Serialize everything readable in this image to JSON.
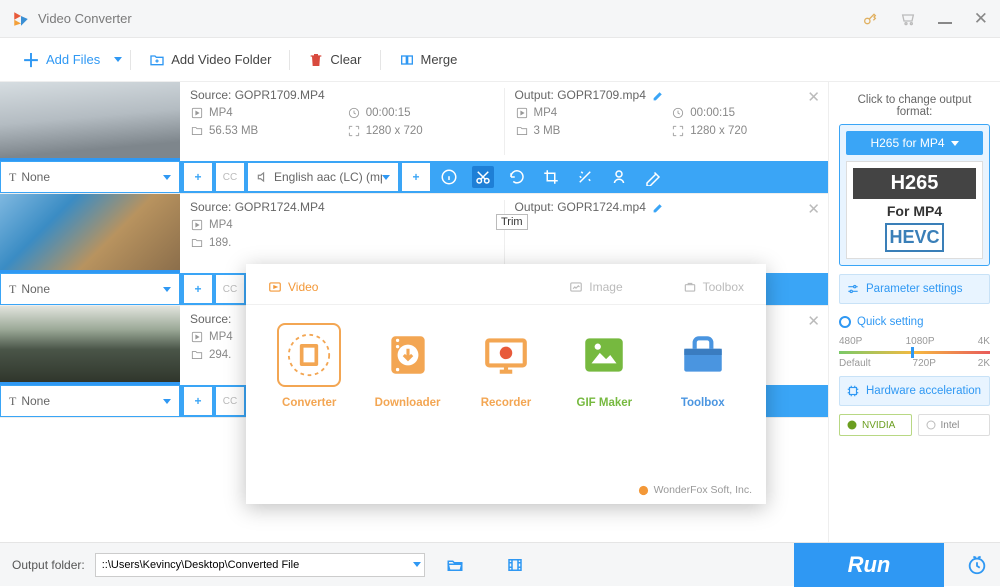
{
  "app": {
    "title": "Video Converter"
  },
  "toolbar": {
    "add_files": "Add Files",
    "add_folder": "Add Video Folder",
    "clear": "Clear",
    "merge": "Merge"
  },
  "files": [
    {
      "thumb_style": "linear-gradient(175deg,#d6dde1 0%,#b4bcc2 45%,#7e868c 80%)",
      "source_label": "Source: GOPR1709.MP4",
      "output_label": "Output: GOPR1709.mp4",
      "src": {
        "format": "MP4",
        "duration": "00:00:15",
        "size": "56.53 MB",
        "res": "1280 x 720"
      },
      "out": {
        "format": "MP4",
        "duration": "00:00:15",
        "size": "3 MB",
        "res": "1280 x 720"
      },
      "subtitle": "None",
      "audio": "English aac (LC) (mp"
    },
    {
      "thumb_style": "linear-gradient(135deg,#7fb8e0 0%,#3a8cc4 30%,#b8935f 60%,#8a6d4a 100%)",
      "source_label": "Source: GOPR1724.MP4",
      "output_label": "Output: GOPR1724.mp4",
      "src": {
        "format": "MP4",
        "size": "189."
      },
      "subtitle": "None"
    },
    {
      "thumb_style": "linear-gradient(180deg,#e2e4dd 0%,#9aa896 30%,#4a5548 55%,#2d3329 100%)",
      "source_label": "Source:",
      "src": {
        "format": "MP4",
        "size": "294."
      },
      "subtitle": "None"
    }
  ],
  "tooltip": {
    "trim": "Trim"
  },
  "popup": {
    "tabs": {
      "video": "Video",
      "image": "Image",
      "toolbox": "Toolbox"
    },
    "modules": {
      "converter": "Converter",
      "downloader": "Downloader",
      "recorder": "Recorder",
      "gif": "GIF Maker",
      "toolbox": "Toolbox"
    },
    "vendor": "WonderFox Soft, Inc."
  },
  "side": {
    "change_label": "Click to change output format:",
    "format_name": "H265 for MP4",
    "codec_top": "H265",
    "codec_mid": "For MP4",
    "codec_bot": "HEVC",
    "params": "Parameter settings",
    "quick": "Quick setting",
    "slider": {
      "p1": "480P",
      "p2": "1080P",
      "p3": "4K",
      "d1": "Default",
      "d2": "720P",
      "d3": "2K"
    },
    "hw": "Hardware acceleration",
    "nvidia": "NVIDIA",
    "intel": "Intel"
  },
  "footer": {
    "label": "Output folder:",
    "path": "::\\Users\\Kevincy\\Desktop\\Converted File",
    "run": "Run"
  }
}
